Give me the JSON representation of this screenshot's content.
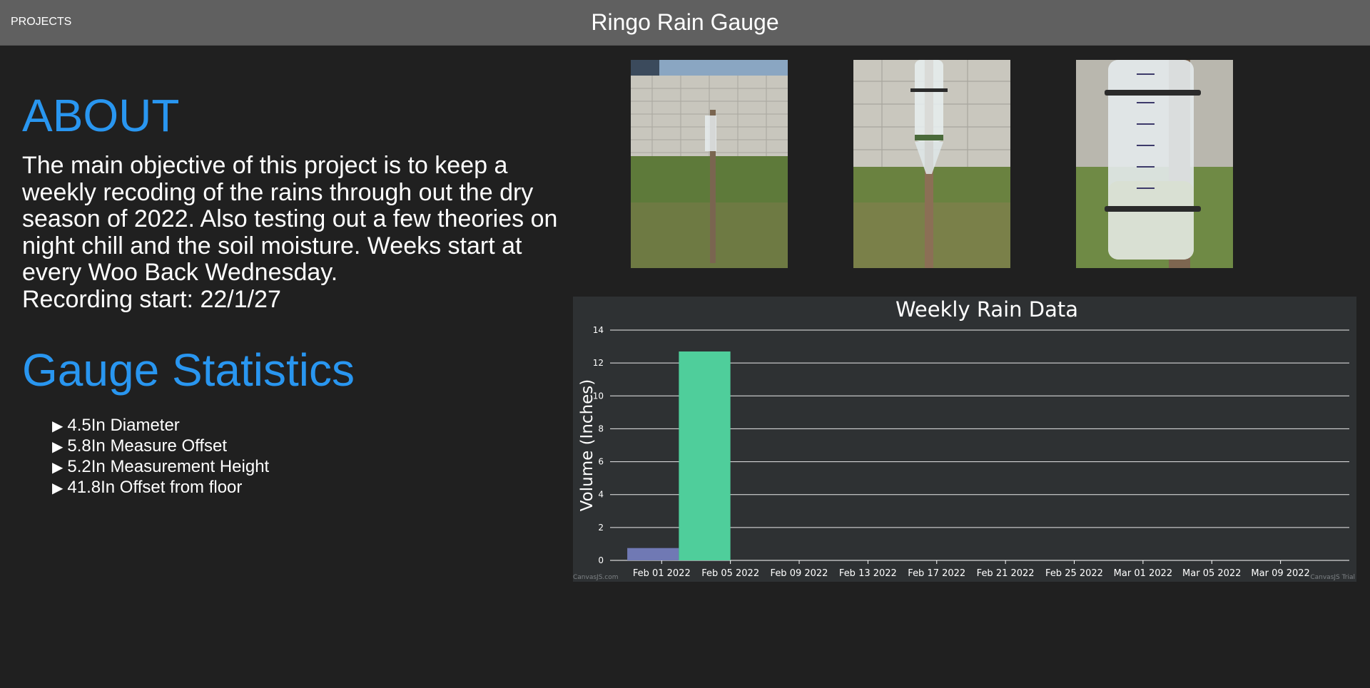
{
  "header": {
    "projects_label": "PROJECTS",
    "site_title": "Ringo Rain Gauge"
  },
  "about": {
    "heading": "ABOUT",
    "text": "The main objective of this project is to keep a weekly recoding of the rains through out the dry season of 2022. Also testing out a few theories on night chill and the soil moisture. Weeks start at every Woo Back Wednesday.",
    "recording_start": "Recording start: 22/1/27"
  },
  "stats": {
    "heading": "Gauge Statistics",
    "items": [
      "4.5In Diameter",
      "5.8In Measure Offset",
      "5.2In Measurement Height",
      "41.8In Offset from floor"
    ]
  },
  "photos": [
    {
      "icon": "rain-gauge-photo-wide"
    },
    {
      "icon": "rain-gauge-photo-mid"
    },
    {
      "icon": "rain-gauge-photo-closeup"
    }
  ],
  "chart_data": {
    "type": "bar",
    "title": "Weekly Rain Data",
    "xlabel": "",
    "ylabel": "Volume (Inches)",
    "ylim": [
      0,
      14
    ],
    "yticks": [
      0,
      2,
      4,
      6,
      8,
      10,
      12,
      14
    ],
    "x_tick_labels": [
      "Feb 01 2022",
      "Feb 05 2022",
      "Feb 09 2022",
      "Feb 13 2022",
      "Feb 17 2022",
      "Feb 21 2022",
      "Feb 25 2022",
      "Mar 01 2022",
      "Mar 05 2022",
      "Mar 09 2022"
    ],
    "xlim": [
      "2022-01-29",
      "2022-03-13"
    ],
    "grid": true,
    "bars": [
      {
        "date": "2022-01-30",
        "end": "2022-02-02",
        "value": 0.75,
        "color": "#7079b4"
      },
      {
        "date": "2022-02-02",
        "end": "2022-02-05",
        "value": 12.7,
        "color": "#4fce9b"
      }
    ],
    "background": "#2e3133",
    "credit_left": "CanvasJS.com",
    "credit_right": "CanvasJS Trial"
  }
}
